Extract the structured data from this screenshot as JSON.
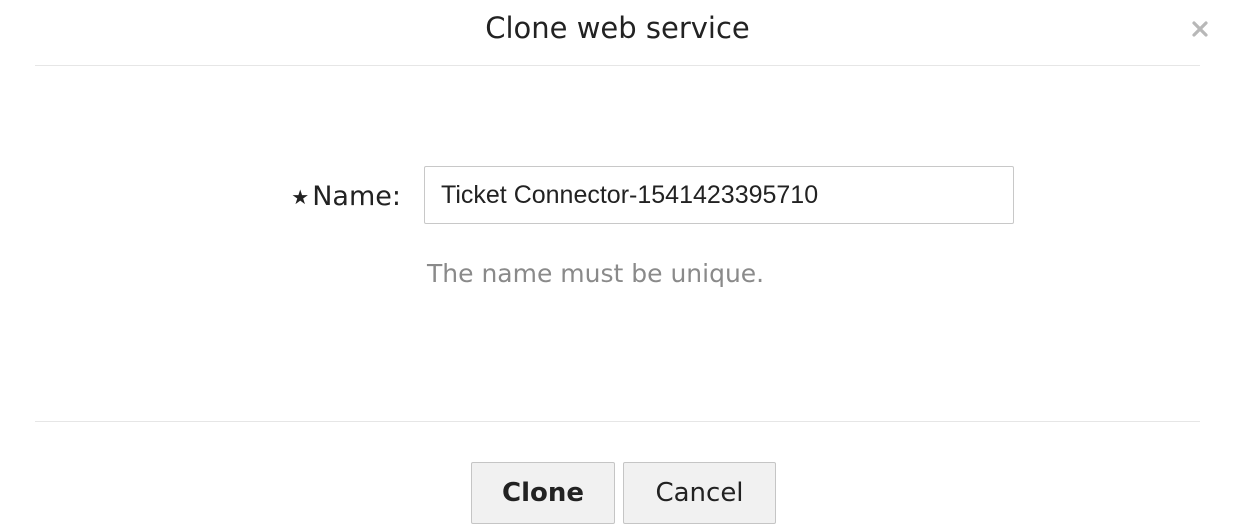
{
  "dialog": {
    "title": "Clone web service",
    "close_icon": "close-icon"
  },
  "form": {
    "required_marker": "★",
    "name_label": "Name:",
    "name_value": "Ticket Connector-1541423395710",
    "hint": "The name must be unique."
  },
  "actions": {
    "clone_label": "Clone",
    "cancel_label": "Cancel"
  }
}
